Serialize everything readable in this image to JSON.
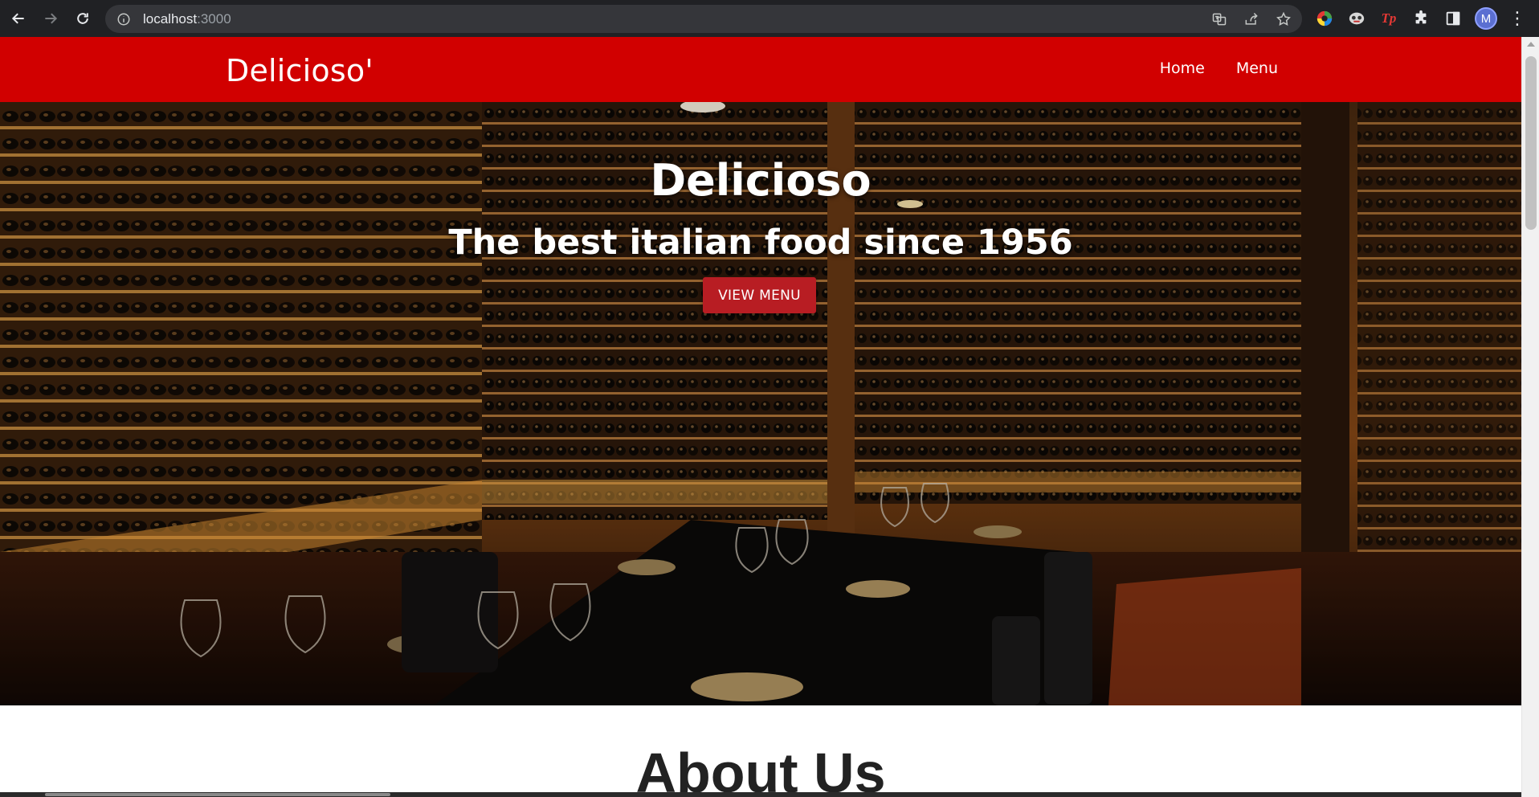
{
  "browser": {
    "url_host": "localhost",
    "url_port": ":3000",
    "avatar_letter": "M",
    "ext_tp_label": "Tp"
  },
  "site": {
    "brand": "Delicioso'",
    "nav": [
      "Home",
      "Menu"
    ]
  },
  "hero": {
    "title": "Delicioso",
    "subtitle": "The best italian food since 1956",
    "button": "VIEW MENU"
  },
  "about": {
    "title": "About Us"
  },
  "colors": {
    "header_red": "#d10000",
    "button_red": "#b81d23"
  }
}
